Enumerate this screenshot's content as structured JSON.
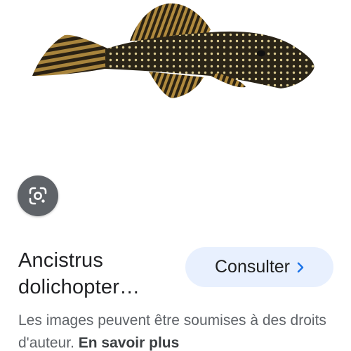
{
  "hero": {
    "image_subject": "Ancistrus dolichopterus catfish",
    "image_background": "#ffffff"
  },
  "lens": {
    "icon": "google-lens-icon",
    "color": "#5f6368"
  },
  "result": {
    "title_line1": "Ancistrus",
    "title_line2": "dolichopter…"
  },
  "visit_button": {
    "label": "Consulter",
    "icon": "chevron-right-icon",
    "background": "#e8f0fe",
    "accent": "#1a73e8"
  },
  "notice": {
    "text": "Les images peuvent être soumises à des droits d'auteur.",
    "link_label": "En savoir plus"
  }
}
